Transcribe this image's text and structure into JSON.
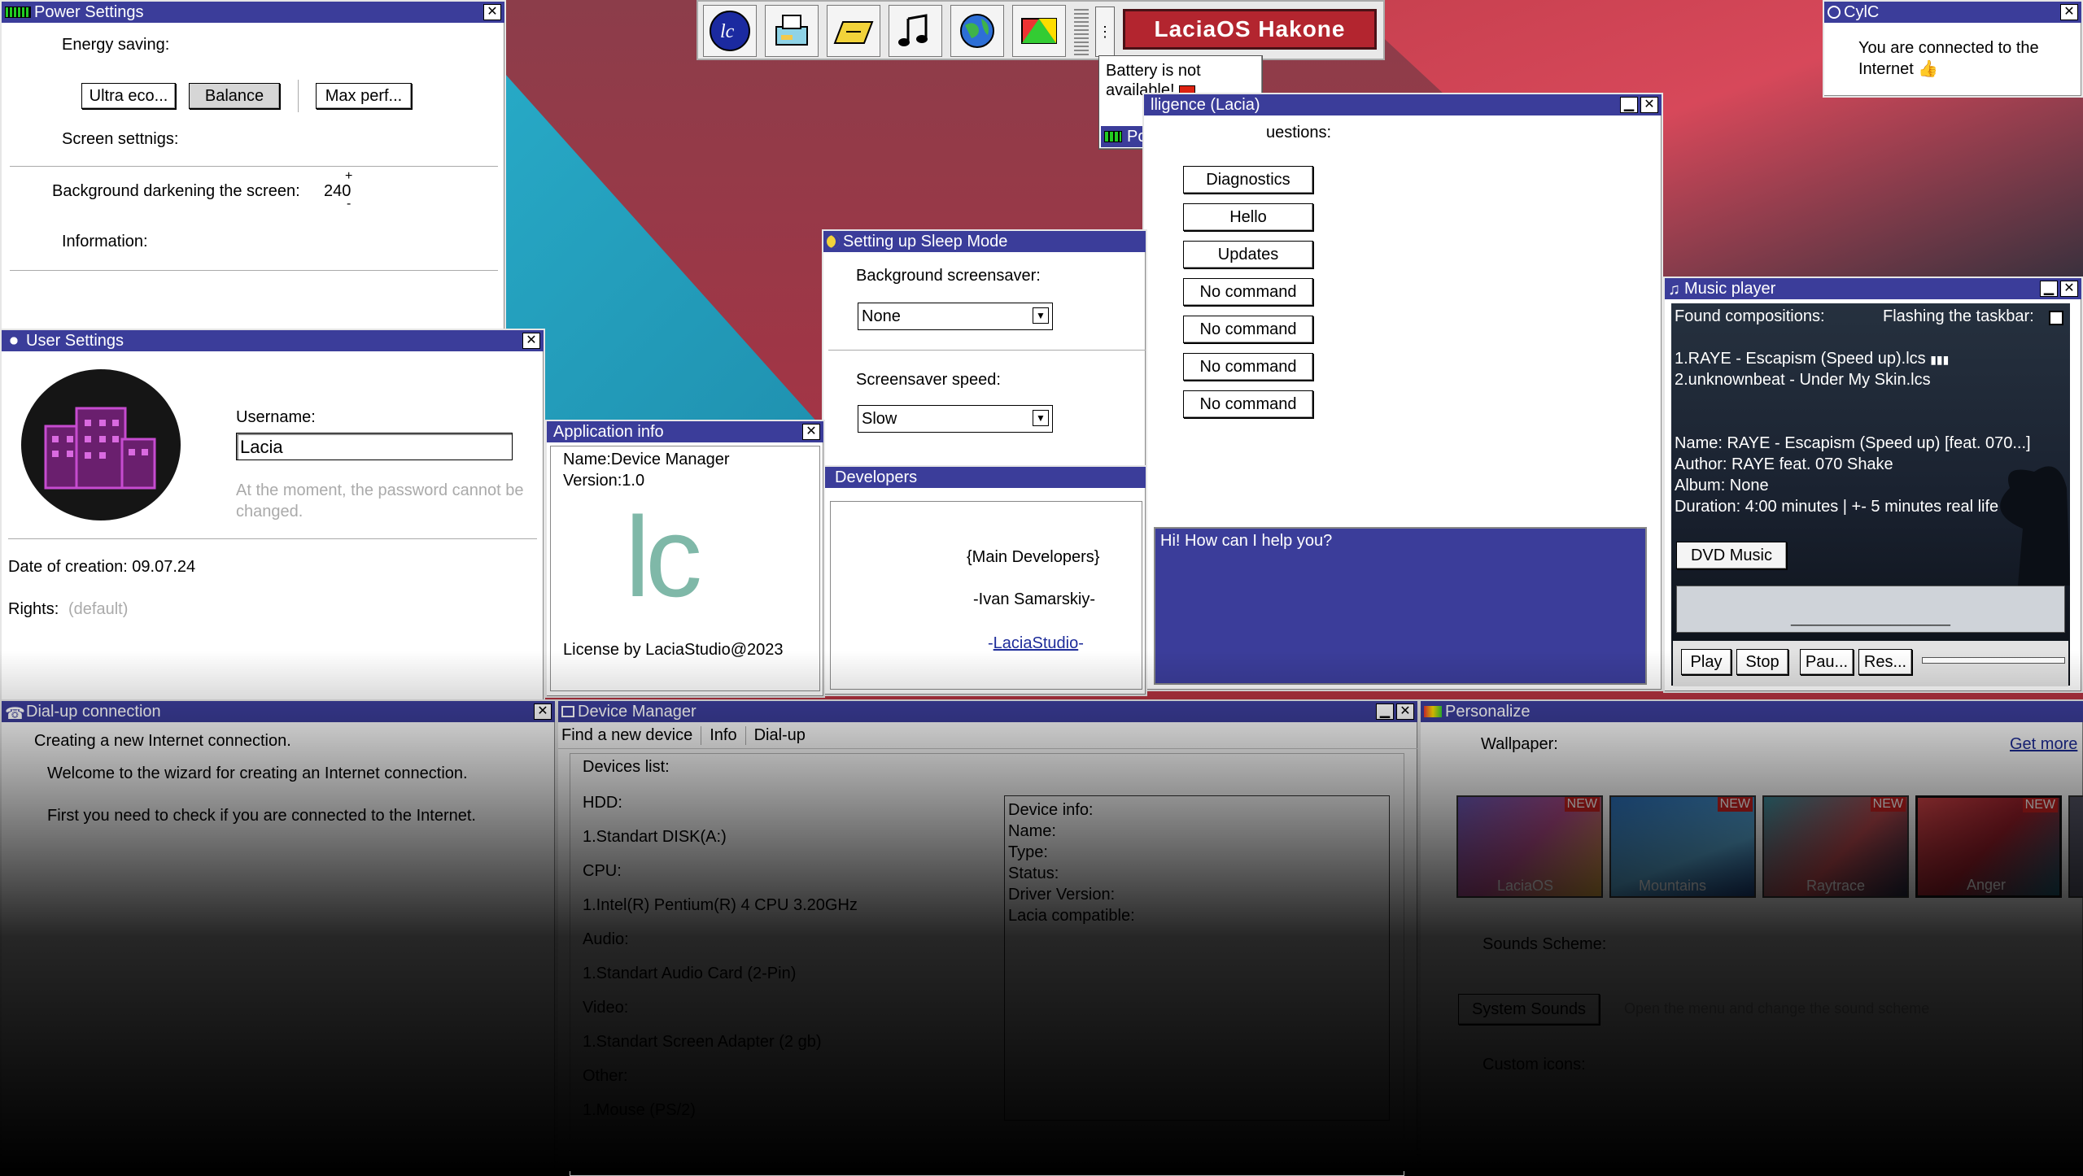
{
  "taskbar": {
    "icons": [
      "lc-logo-icon",
      "printer-icon",
      "folder-icon",
      "music-note-icon",
      "globe-icon",
      "paint-icon"
    ],
    "brand": "LaciaOS Hakone"
  },
  "battery_popup": {
    "message": "Battery is not available!",
    "power_supply": "Power supply"
  },
  "power_settings": {
    "title": "Power Settings",
    "energy_saving": "Energy saving:",
    "buttons": [
      "Ultra eco...",
      "Balance",
      "Max perf..."
    ],
    "screen_settings": "Screen settnigs:",
    "darkening_label": "Background darkening the screen:",
    "darkening_value": "240",
    "information": "Information:"
  },
  "cylc": {
    "title": "CylC",
    "message": "You are connected to the Internet"
  },
  "user_settings": {
    "title": "User Settings",
    "username_label": "Username:",
    "username_value": "Lacia",
    "password_note": "At the moment, the password cannot be changed.",
    "date_of_creation": "Date of creation: 09.07.24",
    "rights_label": "Rights:",
    "rights_value": "(default)"
  },
  "app_info": {
    "title": "Application info",
    "name": "Name:Device Manager",
    "version": "Version:1.0",
    "logo_text": "lc",
    "license": "License by LaciaStudio@2023"
  },
  "sleep_mode": {
    "title": "Setting up Sleep Mode",
    "bg_label": "Background screensaver:",
    "bg_value": "None",
    "speed_label": "Screensaver speed:",
    "speed_value": "Slow"
  },
  "developers": {
    "title": "Developers",
    "heading": "{Main Developers}",
    "dev1": "-Ivan Samarskiy-",
    "studio": "LaciaStudio",
    "dash_left": "-",
    "dash_right": "-"
  },
  "ai": {
    "title": "lligence (Lacia)",
    "questions_label": "uestions:",
    "buttons": [
      "Diagnostics",
      "Hello",
      "Updates",
      "No command",
      "No command",
      "No command",
      "No command"
    ],
    "chat": "Hi! How can I help you?"
  },
  "music": {
    "title": "Music player",
    "found": "Found compositions:",
    "flash": "Flashing the taskbar:",
    "tracks": [
      "1.RAYE - Escapism (Speed up).lcs",
      "2.unknownbeat - Under My Skin.lcs"
    ],
    "name": "Name: RAYE - Escapism (Speed up) [feat. 070...]",
    "author": "Author: RAYE feat. 070 Shake",
    "album": "Album: None",
    "duration": "Duration: 4:00 minutes | +- 5 minutes real life",
    "dvd": "DVD Music",
    "progress": "________________",
    "controls": [
      "Play",
      "Stop",
      "Pau...",
      "Res..."
    ]
  },
  "dialup": {
    "title": "Dial-up connection",
    "line1": "Creating a new Internet connection.",
    "line2": "Welcome to the wizard for creating an Internet connection.",
    "line3": "First you need to check if you are connected to the Internet."
  },
  "device_manager": {
    "title": "Device Manager",
    "menu": [
      "Find a new device",
      "Info",
      "Dial-up"
    ],
    "devices_list": "Devices list:",
    "groups": [
      {
        "label": "HDD:",
        "item": "1.Standart DISK(A:)"
      },
      {
        "label": "CPU:",
        "item": "1.Intel(R) Pentium(R) 4 CPU 3.20GHz"
      },
      {
        "label": "Audio:",
        "item": "1.Standart Audio Card (2-Pin)"
      },
      {
        "label": "Video:",
        "item": "1.Standart Screen Adapter (2 gb)"
      },
      {
        "label": "Other:",
        "item": "1.Mouse (PS/2)"
      }
    ],
    "info": [
      "Device info:",
      "Name:",
      "Type:",
      "Status:",
      "Driver Version:",
      "Lacia compatible:"
    ]
  },
  "personalize": {
    "title": "Personalize",
    "wallpaper_label": "Wallpaper:",
    "get_more": "Get more",
    "wallpapers": [
      {
        "name": "LaciaOS",
        "badge": "NEW"
      },
      {
        "name": "Mountains",
        "badge": "NEW"
      },
      {
        "name": "Raytrace",
        "badge": "NEW"
      },
      {
        "name": "Anger",
        "badge": "NEW"
      }
    ],
    "sounds_label": "Sounds Scheme:",
    "system_sounds": "System Sounds",
    "sounds_note": "Open the menu and change the sound scheme",
    "custom_icons": "Custom icons:"
  }
}
